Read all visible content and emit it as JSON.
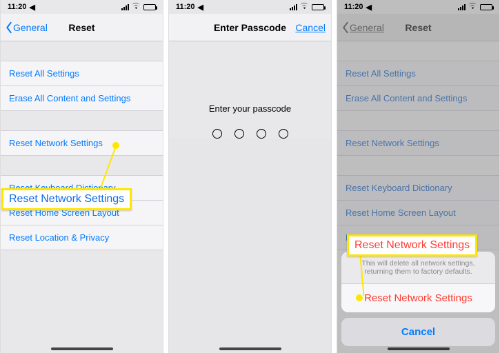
{
  "status": {
    "time": "11:20",
    "location_glyph": "◂"
  },
  "screen1": {
    "back_label": "General",
    "title": "Reset",
    "rows": {
      "r0": "Reset All Settings",
      "r1": "Erase All Content and Settings",
      "r2": "Reset Network Settings",
      "r3": "Reset Keyboard Dictionary",
      "r4": "Reset Home Screen Layout",
      "r5": "Reset Location & Privacy"
    },
    "callout": "Reset Network Settings"
  },
  "screen2": {
    "title": "Enter Passcode",
    "cancel": "Cancel",
    "prompt": "Enter your passcode"
  },
  "screen3": {
    "back_label": "General",
    "title": "Reset",
    "rows": {
      "r0": "Reset All Settings",
      "r1": "Erase All Content and Settings",
      "r2": "Reset Network Settings",
      "r3": "Reset Keyboard Dictionary",
      "r4": "Reset Home Screen Layout",
      "r5": "Reset Location & Privacy"
    },
    "sheet": {
      "message": "This will delete all network settings, returning them to factory defaults.",
      "action": "Reset Network Settings",
      "cancel": "Cancel"
    },
    "callout": "Reset Network Settings"
  }
}
